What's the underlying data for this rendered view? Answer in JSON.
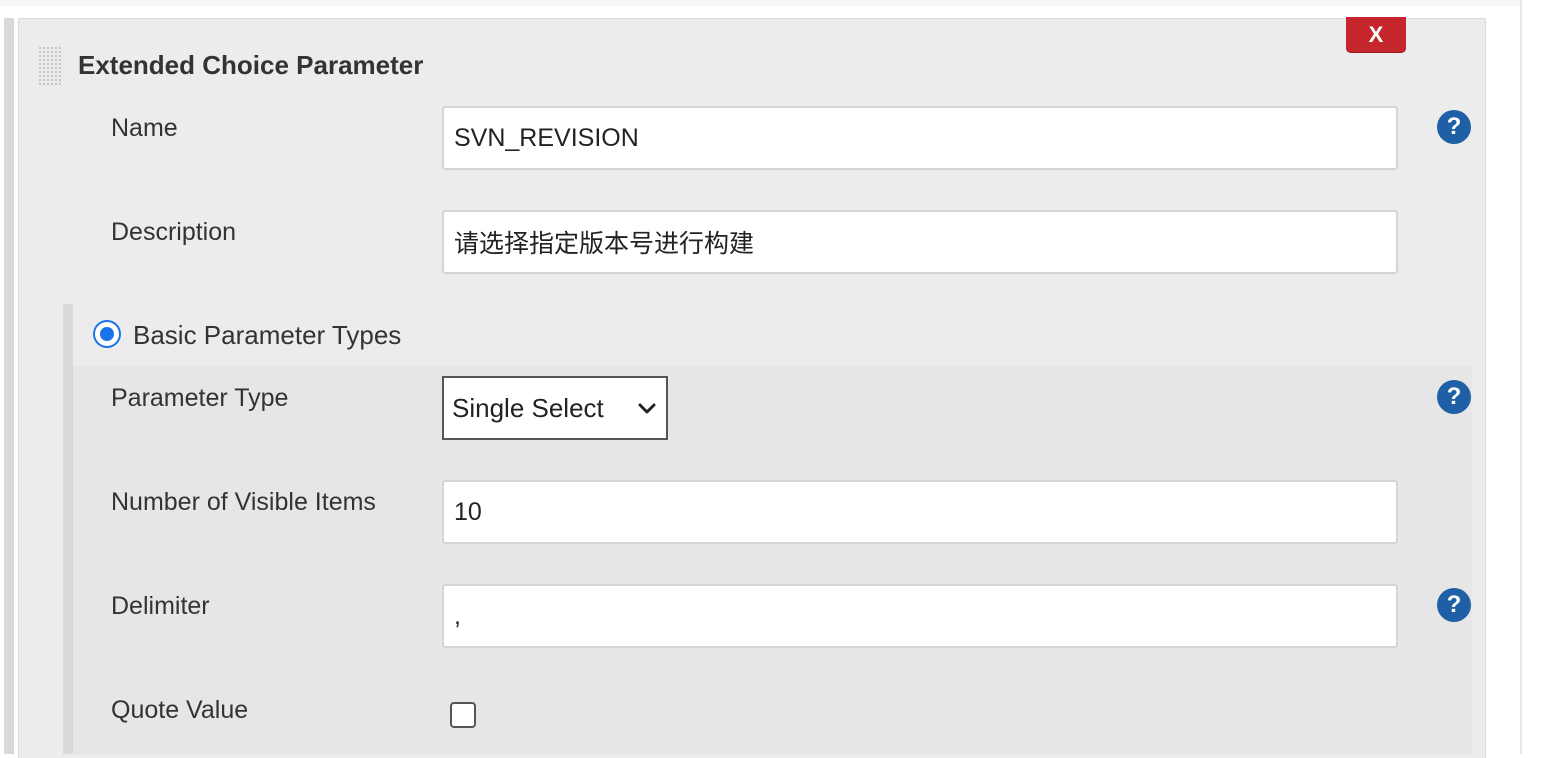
{
  "panel": {
    "title": "Extended Choice Parameter",
    "delete_label": "X"
  },
  "fields": {
    "name": {
      "label": "Name",
      "value": "SVN_REVISION"
    },
    "description": {
      "label": "Description",
      "value": "请选择指定版本号进行构建"
    }
  },
  "basic_types": {
    "radio_label": "Basic Parameter Types",
    "selected": true,
    "parameter_type": {
      "label": "Parameter Type",
      "value": "Single Select"
    },
    "visible_items": {
      "label": "Number of Visible Items",
      "value": "10"
    },
    "delimiter": {
      "label": "Delimiter",
      "value": ","
    },
    "quote_value": {
      "label": "Quote Value",
      "checked": false
    }
  },
  "help": {
    "glyph": "?"
  },
  "colors": {
    "delete_button": "#c4262c",
    "help_icon": "#1f5fa6",
    "radio_accent": "#1a73e8",
    "panel_background": "#ececec"
  }
}
